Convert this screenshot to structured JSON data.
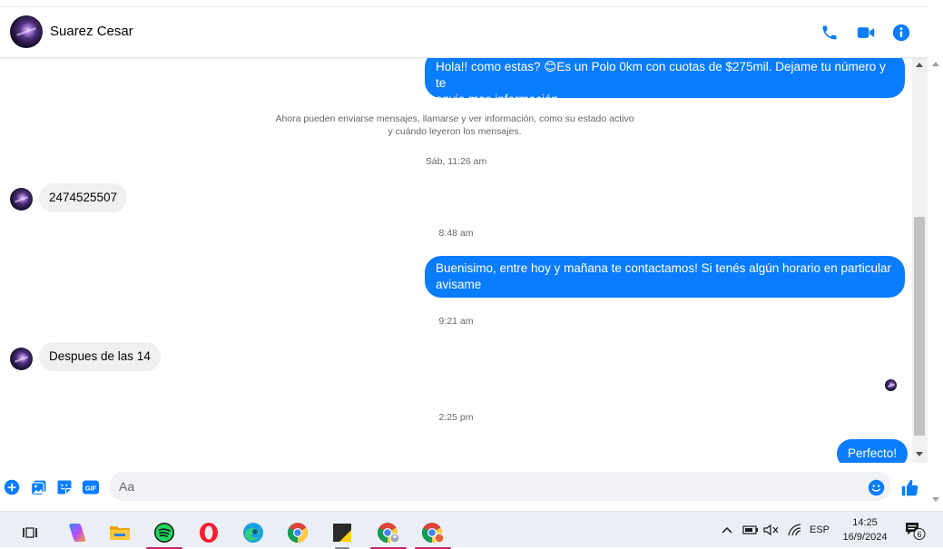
{
  "header": {
    "contact_name": "Suarez Cesar",
    "icons": [
      "phone-icon",
      "video-call-icon",
      "info-icon"
    ]
  },
  "messages": {
    "out_1_line1": "Hola!! como estas? 😊Es un Polo 0km con cuotas de $275mil. Dejame tu número y te",
    "out_1_line2": "envio mas información",
    "system_line1": "Ahora pueden enviarse mensajes, llamarse y ver información, como su estado activo",
    "system_line2": "y cuándo leyeron los mensajes.",
    "ts_1": "Sáb, 11:26 am",
    "in_1": "2474525507",
    "ts_2": "8:48 am",
    "out_2_line1": "Buenisimo, entre hoy y mañana te contactamos! Si tenés algún horario en particular",
    "out_2_line2": "avisame",
    "ts_3": "9:21 am",
    "in_2": "Despues de las 14",
    "ts_4": "2:25 pm",
    "out_3": "Perfecto!"
  },
  "composer": {
    "placeholder": "Aa",
    "icons": [
      "plus-circle-icon",
      "image-icon",
      "sticker-icon",
      "gif-icon",
      "emoji-icon",
      "thumbs-up-icon"
    ],
    "gif_label": "GIF"
  },
  "taskbar": {
    "apps": [
      "task-view-icon",
      "copilot-icon",
      "file-explorer-icon",
      "spotify-icon",
      "opera-icon",
      "edge-icon",
      "chrome-icon",
      "sticky-notes-icon",
      "chrome-profile-1-icon",
      "chrome-profile-2-icon"
    ],
    "language": "ESP",
    "time": "14:25",
    "date": "16/9/2024",
    "notification_count": "6"
  },
  "colors": {
    "accent": "#0a7cff",
    "incoming_bubble": "#f0f0f0",
    "timestamp_text": "#65676b"
  }
}
